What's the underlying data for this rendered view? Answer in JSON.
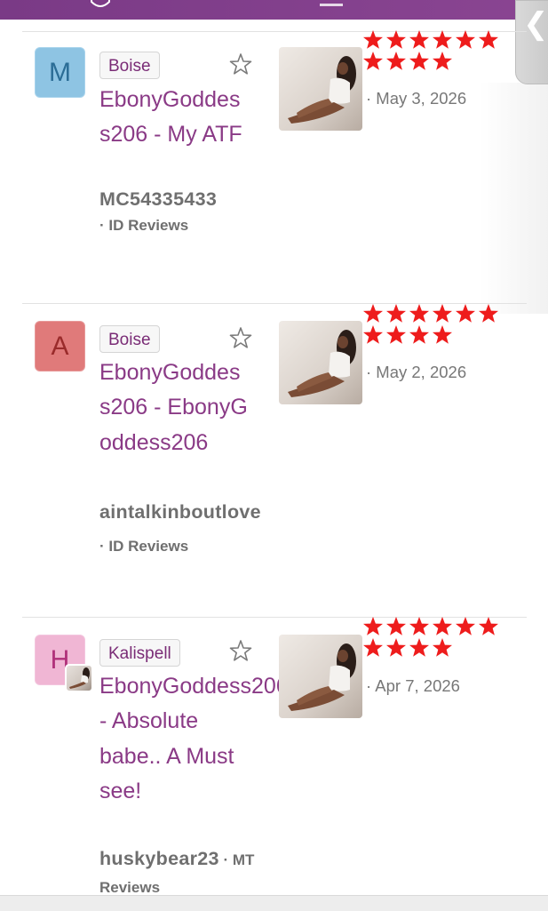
{
  "ui": {
    "brand_color": "#7a3a86",
    "rating_star_color": "#ee1c1c",
    "side_handle_icon": "chevron-left-icon",
    "side_handle_glyph": "❮"
  },
  "reviews": [
    {
      "avatar_letter": "M",
      "location": "Boise",
      "title": "EbonyGoddess206 - My ATF",
      "username": "MC54335433",
      "site": "· ID Reviews",
      "date": "· May 3, 2026",
      "rating": 10,
      "favorite_icon": "star-outline-icon"
    },
    {
      "avatar_letter": "A",
      "location": "Boise",
      "title": "EbonyGoddess206 - EbonyGoddess206",
      "username": "aintalkinboutlove",
      "site": " · ID Reviews",
      "date": "· May 2, 2026",
      "rating": 10,
      "favorite_icon": "star-outline-icon"
    },
    {
      "avatar_letter": "H",
      "location": "Kalispell",
      "title": "EbonyGoddess206 - Absolute babe.. A Must see!",
      "username": "huskybear23",
      "site": " · MT Reviews",
      "date": "· Apr 7, 2026",
      "rating": 10,
      "favorite_icon": "star-outline-icon"
    }
  ]
}
